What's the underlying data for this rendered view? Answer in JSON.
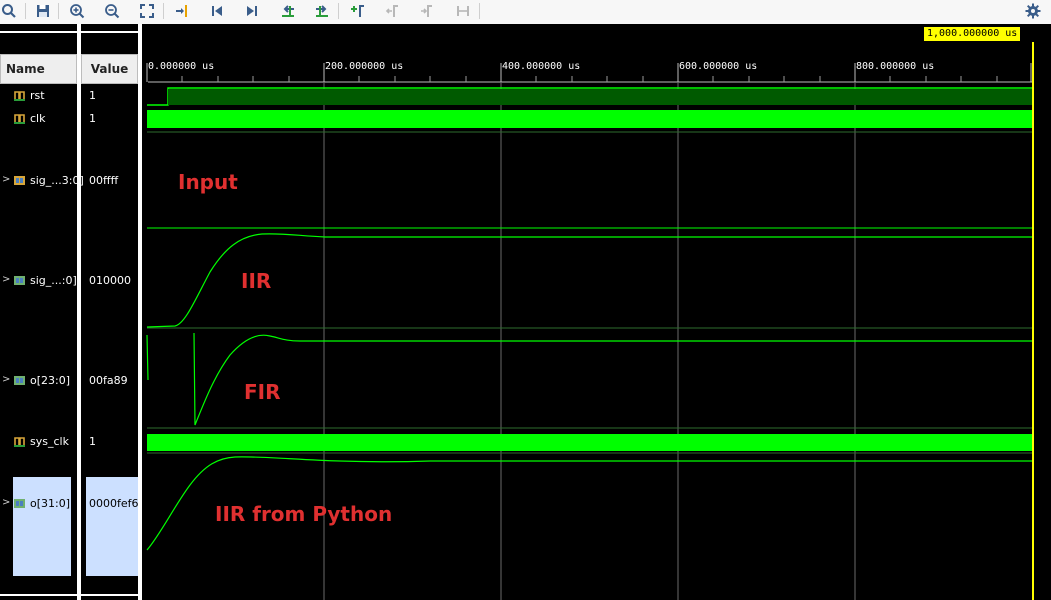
{
  "toolbar": {
    "buttons": [
      "search-icon",
      "save-icon",
      "zoom-in-icon",
      "zoom-out-icon",
      "zoom-fit-icon",
      "go-to-cursor-icon",
      "go-to-start-icon",
      "go-to-end-icon",
      "previous-transition-icon",
      "next-transition-icon",
      "add-marker-icon",
      "previous-marker-icon",
      "next-marker-icon",
      "swap-cursors-icon"
    ],
    "settings_icon": "gear-icon"
  },
  "columns": {
    "name": "Name",
    "value": "Value"
  },
  "signals": [
    {
      "name": "rst",
      "value": "1",
      "type": "bit"
    },
    {
      "name": "clk",
      "value": "1",
      "type": "bit"
    },
    {
      "name": "sig_...3:0]",
      "value": "00ffff",
      "type": "bus"
    },
    {
      "name": "sig_...:0]",
      "value": "010000",
      "type": "bus"
    },
    {
      "name": "o[23:0]",
      "value": "00fa89",
      "type": "bus"
    },
    {
      "name": "sys_clk",
      "value": "1",
      "type": "bit"
    },
    {
      "name": "o[31:0]",
      "value": "0000fef6",
      "type": "bus",
      "selected": true
    }
  ],
  "timeline": {
    "cursor_label": "1,000.000000 us",
    "ticks": [
      "0.000000 us",
      "200.000000 us",
      "400.000000 us",
      "600.000000 us",
      "800.000000 us"
    ]
  },
  "annotations": [
    "Input",
    "IIR",
    "FIR",
    "IIR from Python"
  ],
  "colors": {
    "wave": "#00ff00",
    "annotation": "#e03030",
    "cursor": "#ffff00",
    "selection": "#cce0ff"
  }
}
